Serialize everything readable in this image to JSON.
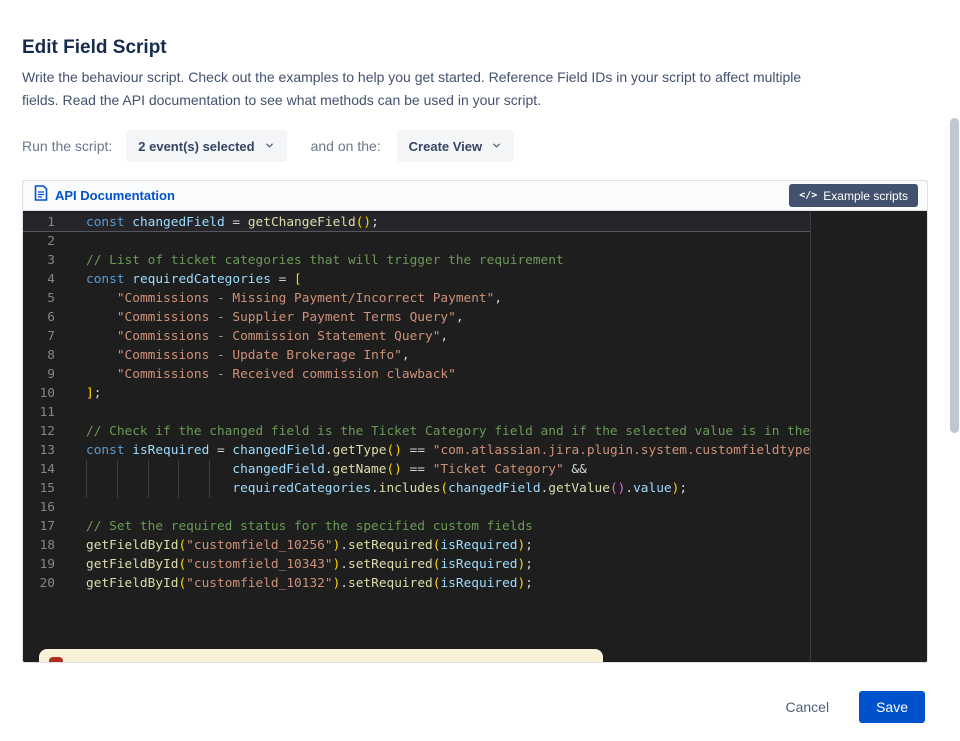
{
  "title": "Edit Field Script",
  "description_lines": [
    "Write the behaviour script. Check out the examples to help you get started. Reference Field IDs in your script to affect multiple",
    "fields. Read the API documentation to see what methods can be used in your script."
  ],
  "controls": {
    "run_label": "Run the script:",
    "events_value": "2 event(s) selected",
    "on_label": "and on the:",
    "view_value": "Create View"
  },
  "toolbar": {
    "api_doc": "API Documentation",
    "example_scripts": "Example scripts",
    "example_icon": "</>"
  },
  "footer": {
    "cancel": "Cancel",
    "save": "Save"
  },
  "colors": {
    "accent": "#0052CC",
    "editor_bg": "#1E1E1E",
    "keyword": "#569CD6",
    "variable": "#9CDCFE",
    "function": "#DCDCAA",
    "string": "#CE9178",
    "comment": "#6A9955",
    "bracket": "#FFD700",
    "warning_bg": "#FAF2D8"
  },
  "editor": {
    "current_line": 1,
    "lines": [
      [
        {
          "t": "const ",
          "c": "kw"
        },
        {
          "t": "changedField ",
          "c": "var"
        },
        {
          "t": "= ",
          "c": "pun"
        },
        {
          "t": "getChangeField",
          "c": "fn"
        },
        {
          "t": "()",
          "c": "b1"
        },
        {
          "t": ";",
          "c": "pun"
        }
      ],
      [],
      [
        {
          "t": "// List of ticket categories that will trigger the requirement",
          "c": "cmt"
        }
      ],
      [
        {
          "t": "const ",
          "c": "kw"
        },
        {
          "t": "requiredCategories ",
          "c": "var"
        },
        {
          "t": "= ",
          "c": "pun"
        },
        {
          "t": "[",
          "c": "b1"
        }
      ],
      [
        {
          "t": "    ",
          "c": "pun"
        },
        {
          "t": "\"Commissions - Missing Payment/Incorrect Payment\"",
          "c": "str"
        },
        {
          "t": ",",
          "c": "pun"
        }
      ],
      [
        {
          "t": "    ",
          "c": "pun"
        },
        {
          "t": "\"Commissions - Supplier Payment Terms Query\"",
          "c": "str"
        },
        {
          "t": ",",
          "c": "pun"
        }
      ],
      [
        {
          "t": "    ",
          "c": "pun"
        },
        {
          "t": "\"Commissions - Commission Statement Query\"",
          "c": "str"
        },
        {
          "t": ",",
          "c": "pun"
        }
      ],
      [
        {
          "t": "    ",
          "c": "pun"
        },
        {
          "t": "\"Commissions - Update Brokerage Info\"",
          "c": "str"
        },
        {
          "t": ",",
          "c": "pun"
        }
      ],
      [
        {
          "t": "    ",
          "c": "pun"
        },
        {
          "t": "\"Commissions - Received commission clawback\"",
          "c": "str"
        }
      ],
      [
        {
          "t": "]",
          "c": "b1"
        },
        {
          "t": ";",
          "c": "pun"
        }
      ],
      [],
      [
        {
          "t": "// Check if the changed field is the Ticket Category field and if the selected value is in the",
          "c": "cmt"
        }
      ],
      [
        {
          "t": "const ",
          "c": "kw"
        },
        {
          "t": "isRequired ",
          "c": "var"
        },
        {
          "t": "= ",
          "c": "pun"
        },
        {
          "t": "changedField",
          "c": "var"
        },
        {
          "t": ".",
          "c": "pun"
        },
        {
          "t": "getType",
          "c": "fn"
        },
        {
          "t": "()",
          "c": "b1"
        },
        {
          "t": " == ",
          "c": "pun"
        },
        {
          "t": "\"com.atlassian.jira.plugin.system.customfieldtype",
          "c": "str"
        }
      ],
      [
        {
          "g": 4
        },
        {
          "g": 4
        },
        {
          "g": 4
        },
        {
          "g": 4
        },
        {
          "g": 3
        },
        {
          "t": "changedField",
          "c": "var"
        },
        {
          "t": ".",
          "c": "pun"
        },
        {
          "t": "getName",
          "c": "fn"
        },
        {
          "t": "()",
          "c": "b1"
        },
        {
          "t": " == ",
          "c": "pun"
        },
        {
          "t": "\"Ticket Category\"",
          "c": "str"
        },
        {
          "t": " &&",
          "c": "pun"
        }
      ],
      [
        {
          "g": 4
        },
        {
          "g": 4
        },
        {
          "g": 4
        },
        {
          "g": 4
        },
        {
          "g": 3
        },
        {
          "t": "requiredCategories",
          "c": "var"
        },
        {
          "t": ".",
          "c": "pun"
        },
        {
          "t": "includes",
          "c": "fn"
        },
        {
          "t": "(",
          "c": "b1"
        },
        {
          "t": "changedField",
          "c": "var"
        },
        {
          "t": ".",
          "c": "pun"
        },
        {
          "t": "getValue",
          "c": "fn"
        },
        {
          "t": "()",
          "c": "b2"
        },
        {
          "t": ".",
          "c": "pun"
        },
        {
          "t": "value",
          "c": "var"
        },
        {
          "t": ")",
          "c": "b1"
        },
        {
          "t": ";",
          "c": "pun"
        }
      ],
      [],
      [
        {
          "t": "// Set the required status for the specified custom fields",
          "c": "cmt"
        }
      ],
      [
        {
          "t": "getFieldById",
          "c": "fn"
        },
        {
          "t": "(",
          "c": "b1"
        },
        {
          "t": "\"customfield_10256\"",
          "c": "str"
        },
        {
          "t": ")",
          "c": "b1"
        },
        {
          "t": ".",
          "c": "pun"
        },
        {
          "t": "setRequired",
          "c": "fn"
        },
        {
          "t": "(",
          "c": "b1"
        },
        {
          "t": "isRequired",
          "c": "var"
        },
        {
          "t": ")",
          "c": "b1"
        },
        {
          "t": ";",
          "c": "pun"
        }
      ],
      [
        {
          "t": "getFieldById",
          "c": "fn"
        },
        {
          "t": "(",
          "c": "b1"
        },
        {
          "t": "\"customfield_10343\"",
          "c": "str"
        },
        {
          "t": ")",
          "c": "b1"
        },
        {
          "t": ".",
          "c": "pun"
        },
        {
          "t": "setRequired",
          "c": "fn"
        },
        {
          "t": "(",
          "c": "b1"
        },
        {
          "t": "isRequired",
          "c": "var"
        },
        {
          "t": ")",
          "c": "b1"
        },
        {
          "t": ";",
          "c": "pun"
        }
      ],
      [
        {
          "t": "getFieldById",
          "c": "fn"
        },
        {
          "t": "(",
          "c": "b1"
        },
        {
          "t": "\"customfield_10132\"",
          "c": "str"
        },
        {
          "t": ")",
          "c": "b1"
        },
        {
          "t": ".",
          "c": "pun"
        },
        {
          "t": "setRequired",
          "c": "fn"
        },
        {
          "t": "(",
          "c": "b1"
        },
        {
          "t": "isRequired",
          "c": "var"
        },
        {
          "t": ")",
          "c": "b1"
        },
        {
          "t": ";",
          "c": "pun"
        }
      ]
    ]
  }
}
